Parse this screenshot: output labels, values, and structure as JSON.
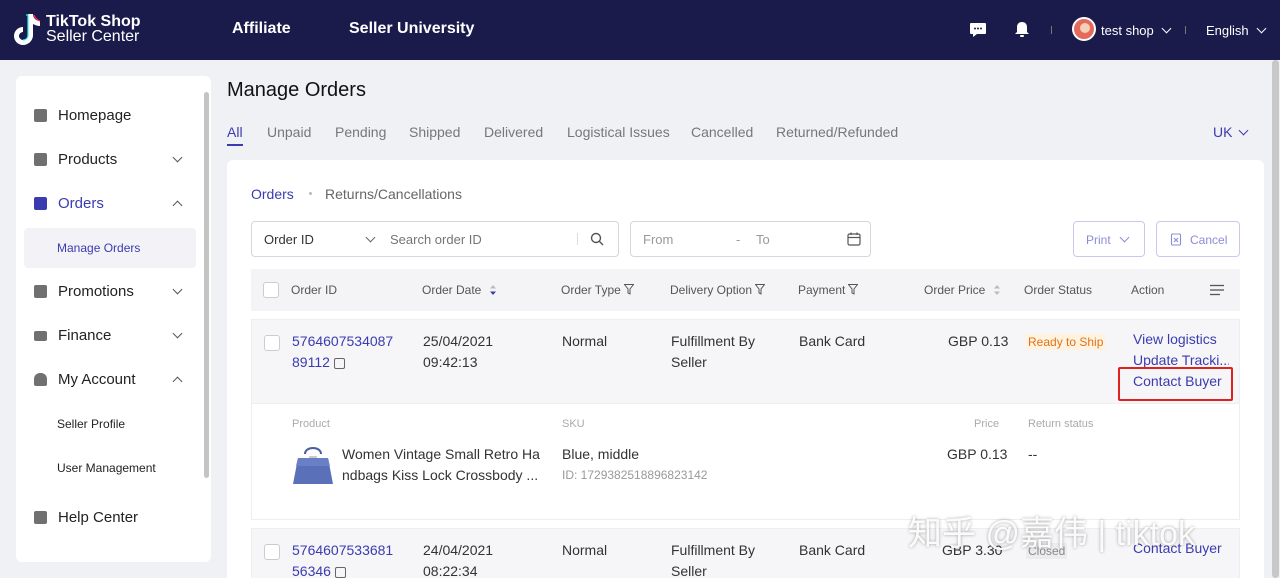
{
  "topbar": {
    "logo_line1": "TikTok Shop",
    "logo_line2": "Seller Center",
    "nav": [
      "Affiliate",
      "Seller University"
    ],
    "user_name": "test shop",
    "language": "English"
  },
  "sidebar": {
    "items": [
      {
        "label": "Homepage"
      },
      {
        "label": "Products"
      },
      {
        "label": "Orders"
      },
      {
        "label": "Manage Orders"
      },
      {
        "label": "Promotions"
      },
      {
        "label": "Finance"
      },
      {
        "label": "My Account"
      },
      {
        "label": "Seller Profile"
      },
      {
        "label": "User Management"
      },
      {
        "label": "Help Center"
      }
    ]
  },
  "main": {
    "title": "Manage Orders",
    "tabs": [
      "All",
      "Unpaid",
      "Pending",
      "Shipped",
      "Delivered",
      "Logistical Issues",
      "Cancelled",
      "Returned/Refunded"
    ],
    "region": "UK",
    "subtabs": [
      "Orders",
      "Returns/Cancellations"
    ],
    "filter": {
      "select_value": "Order ID",
      "search_placeholder": "Search order ID",
      "date_from": "From",
      "date_sep": "-",
      "date_to": "To"
    },
    "buttons": {
      "print": "Print",
      "cancel": "Cancel"
    },
    "columns": [
      "Order ID",
      "Order Date",
      "Order Type",
      "Delivery Option",
      "Payment",
      "Order Price",
      "Order Status",
      "Action"
    ],
    "orders": [
      {
        "id_line1": "5764607534087",
        "id_line2": "89112",
        "date": "25/04/2021",
        "time": "09:42:13",
        "type": "Normal",
        "delivery_line1": "Fulfillment By",
        "delivery_line2": "Seller",
        "payment": "Bank Card",
        "price": "GBP 0.13",
        "status": "Ready to Ship",
        "actions": [
          "View logistics",
          "Update Tracki...",
          "Contact Buyer"
        ],
        "detail": {
          "labels": {
            "product": "Product",
            "sku": "SKU",
            "price": "Price",
            "return_status": "Return status"
          },
          "product_line1": "Women Vintage Small Retro Ha",
          "product_line2": "ndbags Kiss Lock Crossbody ...",
          "sku": "Blue, middle",
          "sku_id": "ID: 1729382518896823142",
          "price": "GBP 0.13",
          "return_status": "--"
        }
      },
      {
        "id_line1": "5764607533681",
        "id_line2": "56346",
        "date": "24/04/2021",
        "time": "08:22:34",
        "type": "Normal",
        "delivery_line1": "Fulfillment By",
        "delivery_line2": "Seller",
        "payment": "Bank Card",
        "price": "GBP 3.30",
        "status": "Closed",
        "actions": [
          "Contact Buyer"
        ]
      }
    ]
  },
  "watermark": "知乎 @嘉伟 | tiktok",
  "colors": {
    "topbar": "#1a1a4b",
    "accent": "#3b3bb0",
    "highlight": "#e0221f",
    "ready": "#e0731b"
  }
}
